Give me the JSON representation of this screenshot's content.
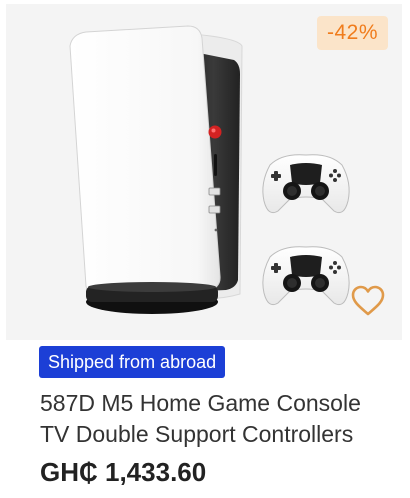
{
  "product": {
    "discount": "-42%",
    "shipping_badge": "Shipped from abroad",
    "title": "587D M5 Home Game Console TV Double Support Controllers",
    "price": "GH₵ 1,433.60"
  },
  "icons": {
    "wishlist": "heart-outline-icon"
  },
  "colors": {
    "discount_text": "#f07c1c",
    "discount_bg": "#fbe4c9",
    "shipping_badge_bg": "#1c3fd6",
    "wishlist_icon": "#e09a4a"
  }
}
